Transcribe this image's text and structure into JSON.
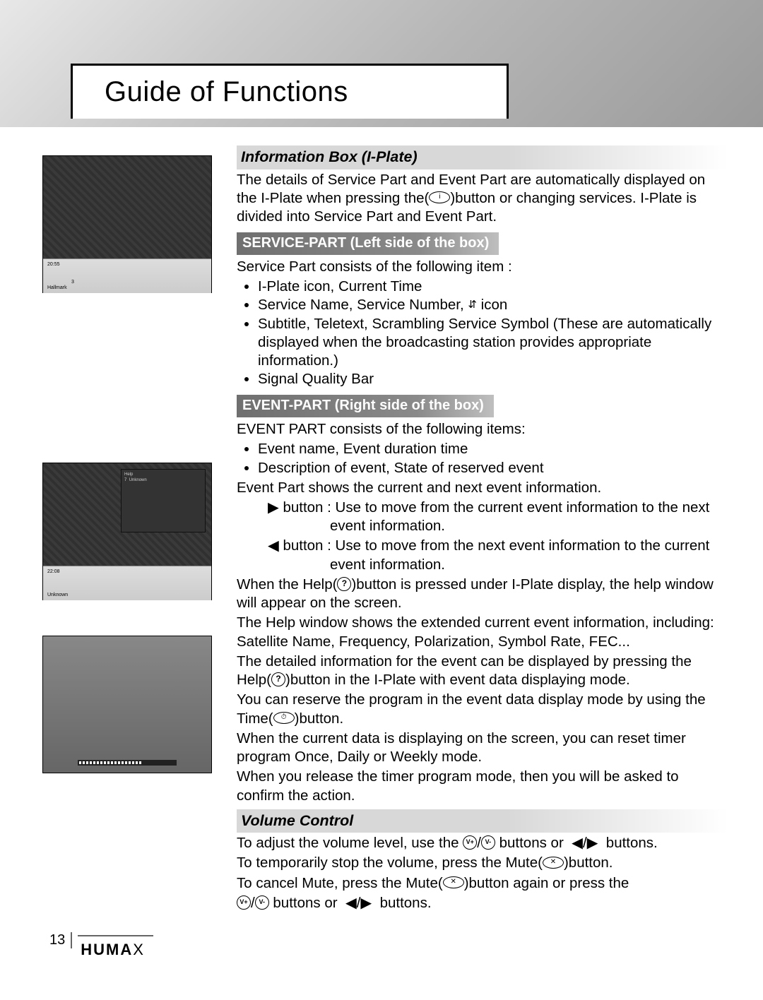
{
  "header": {
    "title": "Guide of Functions"
  },
  "page_number": "13",
  "brand": "HUMAX",
  "section1": {
    "heading": "Information Box (I-Plate)",
    "intro": "The details of Service Part and Event Part are automatically displayed on the I-Plate when pressing the(       )button or changing services. I-Plate is divided into Service Part and Event Part.",
    "sub1": {
      "heading": "SERVICE-PART (Left side of the box)",
      "lead": "Service Part consists of the following item :",
      "items": [
        "I-Plate icon, Current Time",
        "Service Name, Service Number,  icon",
        "Subtitle, Teletext, Scrambling Service Symbol (These are automatically displayed when the broadcasting station provides appropriate information.)",
        "Signal Quality Bar"
      ]
    },
    "sub2": {
      "heading": "EVENT-PART (Right side of the box)",
      "lead": "EVENT PART consists of the following items:",
      "items": [
        "Event name, Event duration time",
        "Description of event, State of reserved event"
      ],
      "line1": "Event Part shows the current and next event information.",
      "btn_right": "▶ button : Use to move from the current event information to the next event information.",
      "btn_left": "◀ button : Use to move from the next event information to the current event information.",
      "help1": "When the Help(     )button is pressed under I-Plate display, the help window will appear on the screen.",
      "help2": "The Help window shows the extended current event information, including: Satellite Name, Frequency, Polarization, Symbol Rate, FEC...",
      "help3": "The detailed information for the event can be displayed by pressing the Help(     )button in the I-Plate with event data displaying mode.",
      "time1": "You can reserve the program in the event data display mode by using the Time(      )button.",
      "time2": "When the current data is displaying on the screen, you can reset timer program Once, Daily or Weekly mode.",
      "time3": "When you release the timer program mode, then you will be asked to confirm the action."
    }
  },
  "section2": {
    "heading": "Volume Control",
    "line1": "To adjust the volume level, use the      /      buttons or  ◀/▶  buttons.",
    "line2": "To temporarily stop the volume, press the Mute(      )button.",
    "line3": "To cancel Mute, press the Mute(      )button again or press the",
    "line4": "     /      buttons or  ◀/▶  buttons."
  },
  "screenshots": {
    "s1": {
      "time": "20:55",
      "ch": "3",
      "name": "Hallmark"
    },
    "s2": {
      "time": "22:08",
      "ch": "7",
      "name": "Unknown",
      "help_title": "Help"
    },
    "s3": {}
  }
}
